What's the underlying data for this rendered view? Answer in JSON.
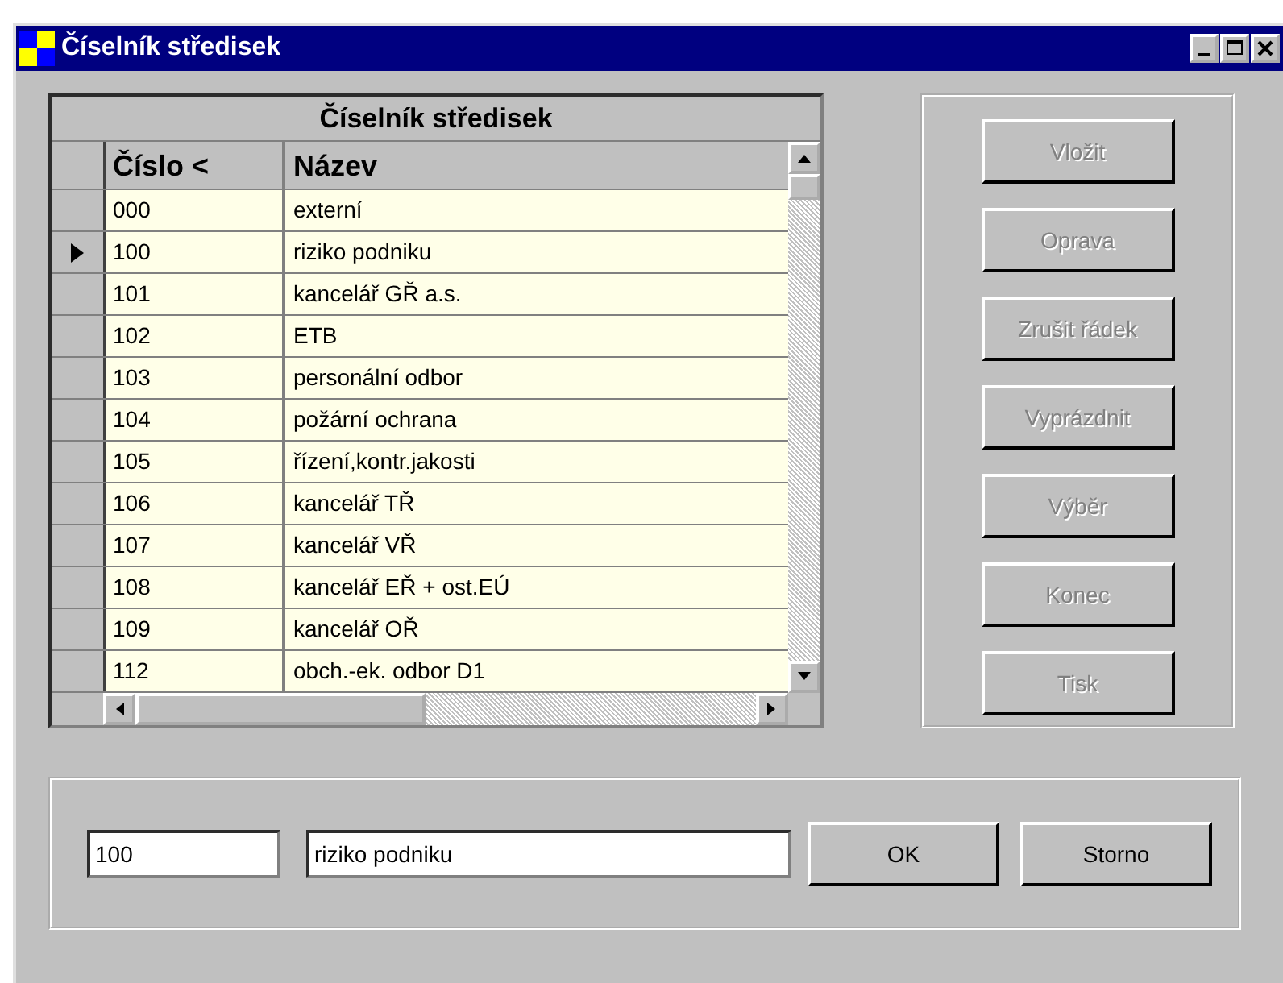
{
  "window": {
    "title": "Číselník středisek"
  },
  "table": {
    "title": "Číselník středisek",
    "columns": [
      "Číslo <",
      "Název"
    ],
    "rows": [
      {
        "cells": [
          "000",
          "externí"
        ],
        "selected": false
      },
      {
        "cells": [
          "100",
          "riziko podniku"
        ],
        "selected": true
      },
      {
        "cells": [
          "101",
          "kancelář GŘ a.s."
        ],
        "selected": false
      },
      {
        "cells": [
          "102",
          "ETB"
        ],
        "selected": false
      },
      {
        "cells": [
          "103",
          "personální odbor"
        ],
        "selected": false
      },
      {
        "cells": [
          "104",
          "požární ochrana"
        ],
        "selected": false
      },
      {
        "cells": [
          "105",
          "řízení,kontr.jakosti"
        ],
        "selected": false
      },
      {
        "cells": [
          "106",
          "kancelář TŘ"
        ],
        "selected": false
      },
      {
        "cells": [
          "107",
          "kancelář VŘ"
        ],
        "selected": false
      },
      {
        "cells": [
          "108",
          "kancelář EŘ + ost.EÚ"
        ],
        "selected": false
      },
      {
        "cells": [
          "109",
          "kancelář OŘ"
        ],
        "selected": false
      },
      {
        "cells": [
          "112",
          "obch.-ek. odbor D1"
        ],
        "selected": false
      }
    ]
  },
  "actions": [
    {
      "label": "Vložit",
      "disabled": true
    },
    {
      "label": "Oprava",
      "disabled": true
    },
    {
      "label": "Zrušit řádek",
      "disabled": true
    },
    {
      "label": "Vyprázdnit",
      "disabled": true
    },
    {
      "label": "Výběr",
      "disabled": true
    },
    {
      "label": "Konec",
      "disabled": true
    },
    {
      "label": "Tisk",
      "disabled": true
    }
  ],
  "editor": {
    "code": "100",
    "name": "riziko podniku",
    "buttons": [
      "OK",
      "Storno"
    ]
  }
}
